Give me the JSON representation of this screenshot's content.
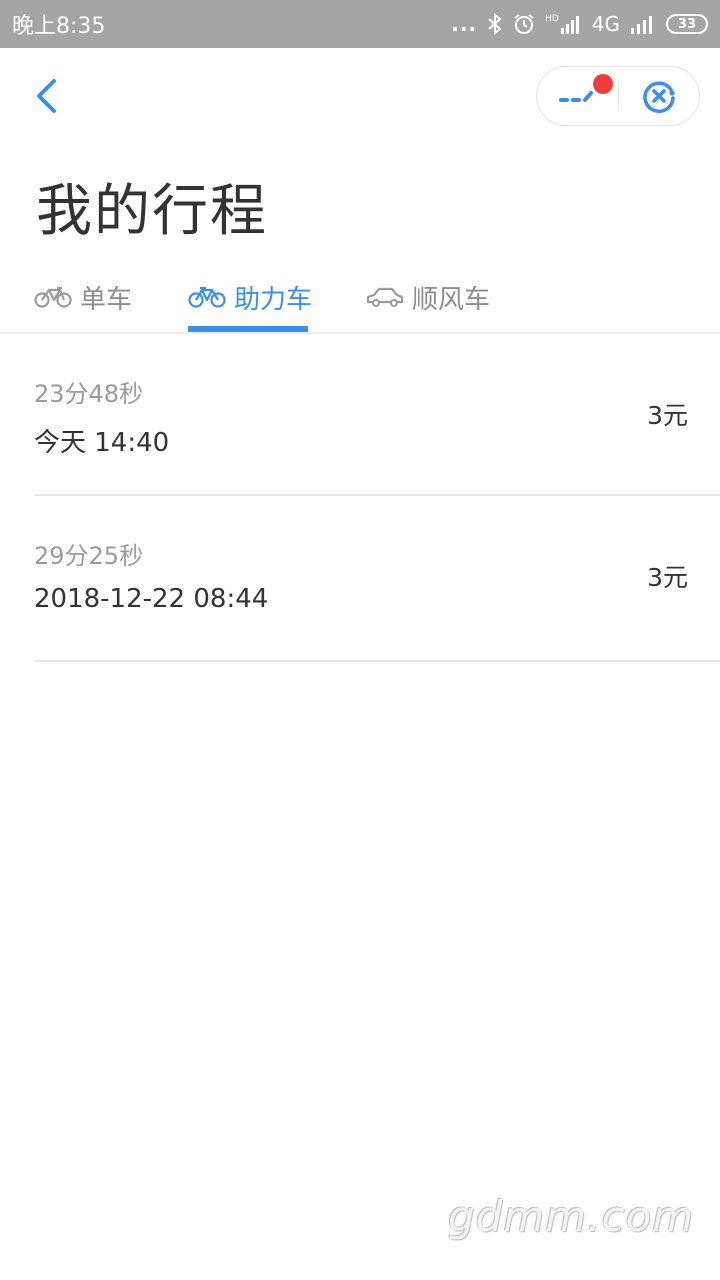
{
  "status_bar": {
    "time": "晚上8:35",
    "dots": "...",
    "hd": "HD",
    "network": "4G",
    "battery": "33"
  },
  "nav": {
    "back_icon": "chevron-left-icon",
    "menu_icon": "more-dots-icon",
    "close_icon": "close-circle-icon"
  },
  "page": {
    "title": "我的行程"
  },
  "tabs": [
    {
      "label": "单车",
      "icon": "bike-icon",
      "active": false
    },
    {
      "label": "助力车",
      "icon": "ebike-icon",
      "active": true
    },
    {
      "label": "顺风车",
      "icon": "car-icon",
      "active": false
    }
  ],
  "trips": [
    {
      "duration": "23分48秒",
      "time": "今天 14:40",
      "price": "3元"
    },
    {
      "duration": "29分25秒",
      "time": "2018-12-22 08:44",
      "price": "3元"
    }
  ],
  "watermark": "gdmm.com",
  "colors": {
    "accent": "#3d8ee6",
    "status_bar": "#a5a5a5",
    "badge": "#f23b3b"
  }
}
